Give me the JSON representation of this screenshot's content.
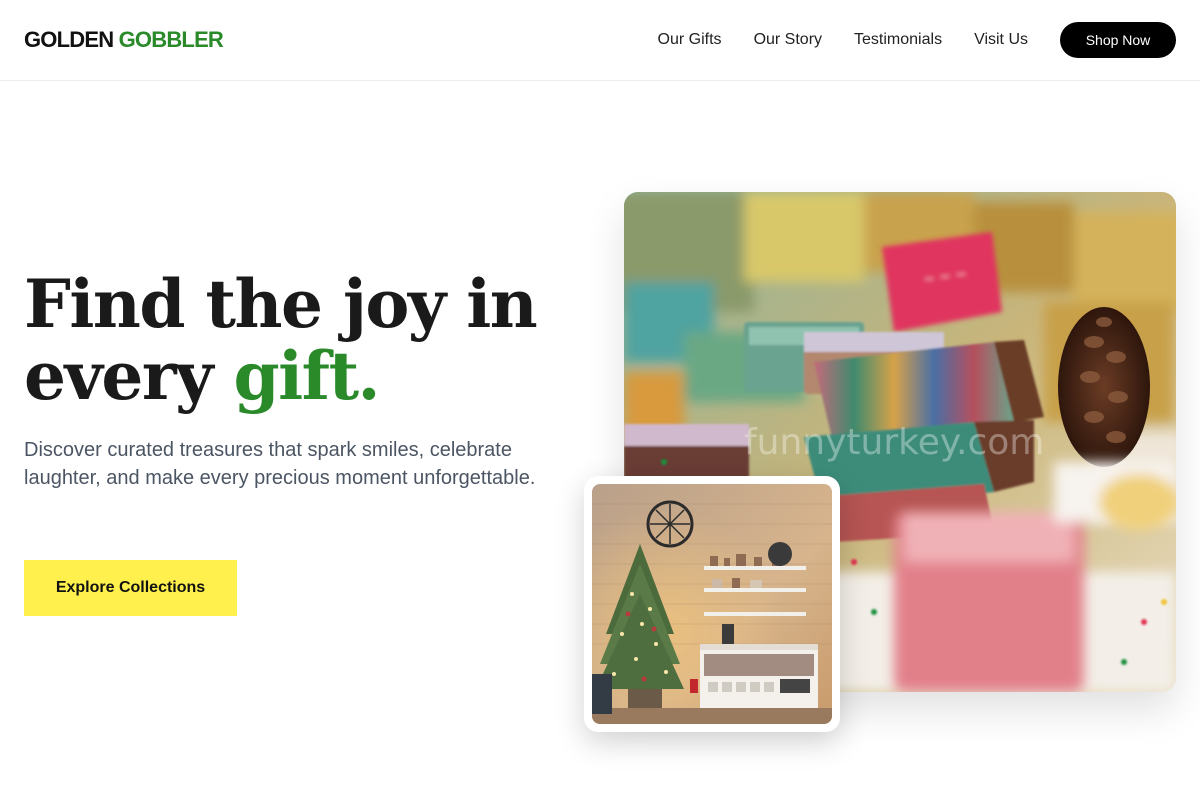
{
  "brand": {
    "part1": "GOLDEN",
    "part2": "GOBBLER",
    "accent_color": "#2a8a2a"
  },
  "nav": {
    "items": [
      {
        "label": "Our Gifts"
      },
      {
        "label": "Our Story"
      },
      {
        "label": "Testimonials"
      },
      {
        "label": "Visit Us"
      }
    ],
    "cta_label": "Shop Now"
  },
  "hero": {
    "headline_line1": "Find the joy in",
    "headline_line2_prefix": "every",
    "headline_accent": "gift.",
    "subtext": "Discover curated treasures that spark smiles, celebrate laughter, and make every precious moment unforgettable.",
    "cta_label": "Explore Collections",
    "cta_color": "#fff04d"
  },
  "images": {
    "main_watermark": "funnyturkey.com"
  }
}
